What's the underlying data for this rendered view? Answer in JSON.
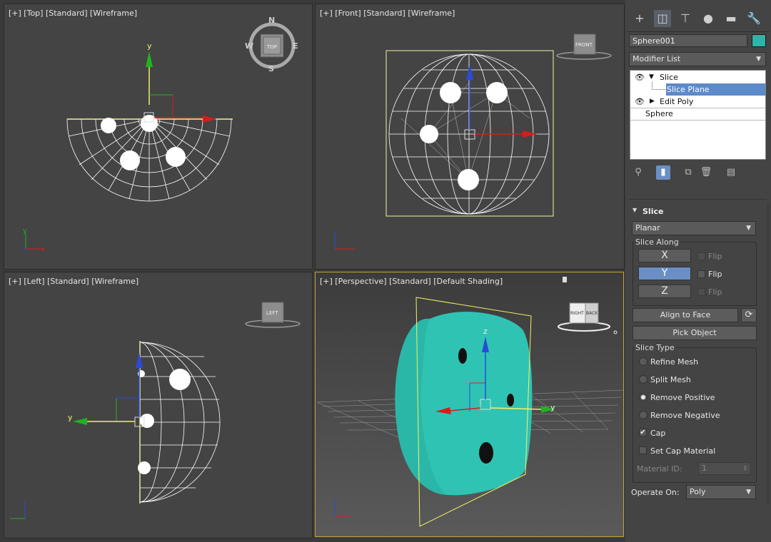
{
  "viewports": {
    "top": {
      "label": "[+] [Top] [Standard] [Wireframe]",
      "axis_x": "x",
      "axis_y": "y",
      "axis_z": "z",
      "compass": {
        "n": "N",
        "s": "S",
        "e": "E",
        "w": "W",
        "cube": "TOP"
      }
    },
    "front": {
      "label": "[+] [Front] [Standard] [Wireframe]",
      "cube": "FRONT"
    },
    "left": {
      "label": "[+] [Left] [Standard] [Wireframe]",
      "cube": "LEFT",
      "axis_y": "y"
    },
    "perspective": {
      "label": "[+] [Perspective] [Standard] [Default Shading]",
      "cube_right": "RIGHT",
      "cube_back": "BACK",
      "gizmo_z": "z",
      "gizmo_y": "y"
    }
  },
  "colors": {
    "object": "#2bb7a8",
    "selection": "#5d8ac9",
    "active_border": "#c9a43a",
    "x_axis": "#d91c1c",
    "y_axis": "#1fb31f",
    "z_axis": "#2a4bd7"
  },
  "command_panel": {
    "tabs": [
      "create-icon",
      "modify-icon",
      "hierarchy-icon",
      "motion-icon",
      "display-icon",
      "utilities-icon"
    ],
    "object_name": "Sphere001",
    "modifier_list": "Modifier List",
    "stack": [
      {
        "label": "Slice",
        "expanded": true
      },
      {
        "label": "Slice Plane",
        "selected": true
      },
      {
        "label": "Edit Poly",
        "expanded": false
      },
      {
        "label": "Sphere"
      }
    ]
  },
  "slice": {
    "title": "Slice",
    "mode": "Planar",
    "slice_along": {
      "title": "Slice Along",
      "axes": [
        {
          "label": "X",
          "flip": "Flip",
          "active": false
        },
        {
          "label": "Y",
          "flip": "Flip",
          "active": true
        },
        {
          "label": "Z",
          "flip": "Flip",
          "active": false
        }
      ]
    },
    "align_to_face": "Align to Face",
    "pick_object": "Pick Object",
    "slice_type": {
      "title": "Slice Type",
      "options": [
        "Refine Mesh",
        "Split Mesh",
        "Remove Positive",
        "Remove Negative"
      ],
      "selected": "Remove Positive"
    },
    "cap": "Cap",
    "cap_checked": true,
    "set_cap_material": "Set Cap Material",
    "material_id_label": "Material ID:",
    "material_id_value": "1",
    "operate_on_label": "Operate On:",
    "operate_on_value": "Poly"
  }
}
